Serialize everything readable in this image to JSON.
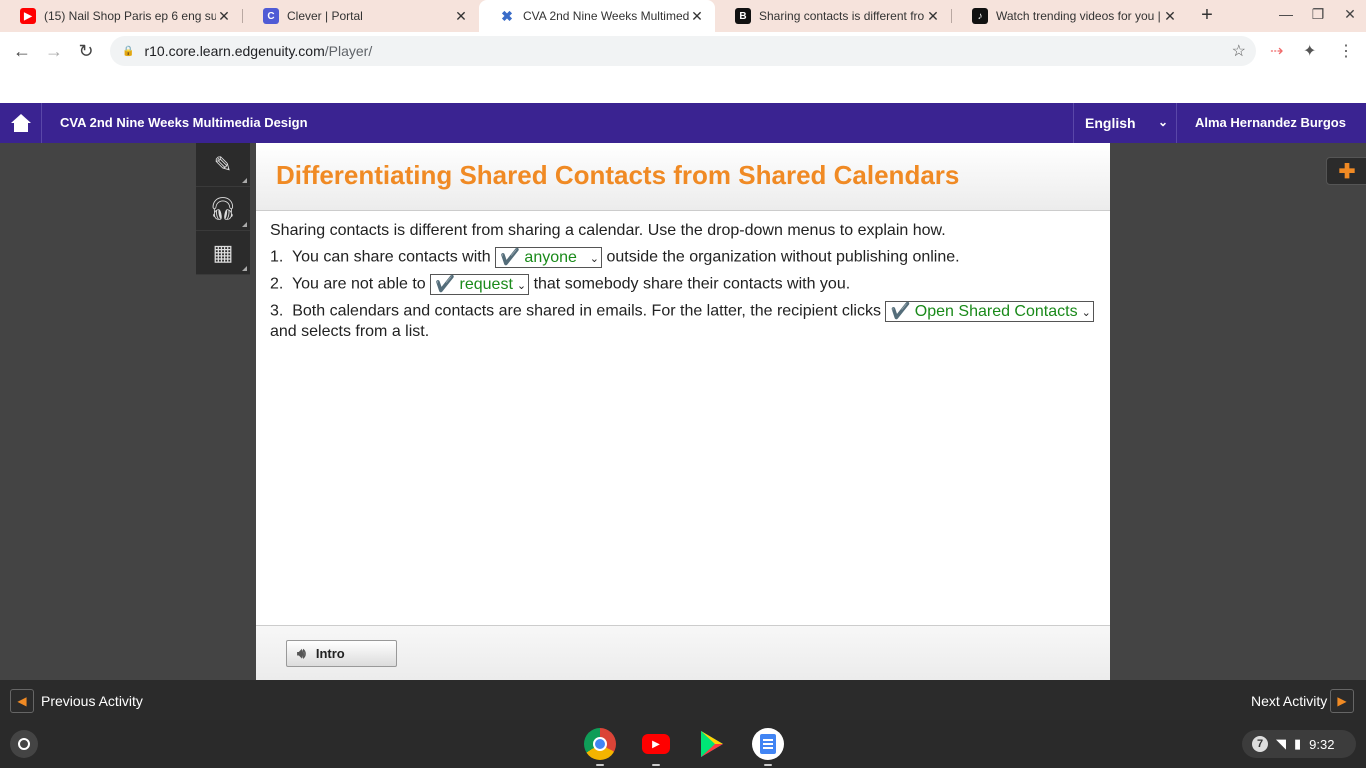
{
  "browser": {
    "tabs": [
      {
        "title": "(15) Nail Shop Paris ep 6 eng su",
        "icon": "youtube-icon",
        "color": "#ff0000"
      },
      {
        "title": "Clever | Portal",
        "icon": "clever-icon",
        "color": "#4f5bd5"
      },
      {
        "title": "CVA 2nd Nine Weeks Multimedi",
        "icon": "edgenuity-icon",
        "color": "#3a6cc8",
        "active": true
      },
      {
        "title": "Sharing contacts is different fro",
        "icon": "brainly-icon",
        "color": "#111111"
      },
      {
        "title": "Watch trending videos for you |",
        "icon": "tiktok-icon",
        "color": "#111111"
      }
    ],
    "url_host": "r10.core.learn.edgenuity.com",
    "url_path": "/Player/"
  },
  "app": {
    "course_title": "CVA 2nd Nine Weeks Multimedia Design",
    "language": "English",
    "user_name": "Alma Hernandez Burgos",
    "accent_color": "#f08a24",
    "header_color": "#3a2391"
  },
  "activity": {
    "title": "Differentiating Shared Contacts from Shared Calendars",
    "instructions": "Sharing contacts is different from sharing a calendar. Use the drop-down menus to explain how.",
    "q1": {
      "num": "1.",
      "before": "You can share contacts with",
      "answer": "✔️ anyone",
      "after": "outside the organization without publishing online."
    },
    "q2": {
      "num": "2.",
      "before": "You are not able to",
      "answer": "✔️ request",
      "after": "that somebody share their contacts with you."
    },
    "q3": {
      "num": "3.",
      "before": "Both calendars and contacts are shared in emails. For the latter, the recipient clicks",
      "answer": "✔️ Open Shared Contacts",
      "after": "and selects from a list."
    },
    "intro_label": "Intro"
  },
  "nav": {
    "previous_label": "Previous Activity",
    "next_label": "Next Activity"
  },
  "shelf": {
    "notification_count": "7",
    "time": "9:32"
  }
}
